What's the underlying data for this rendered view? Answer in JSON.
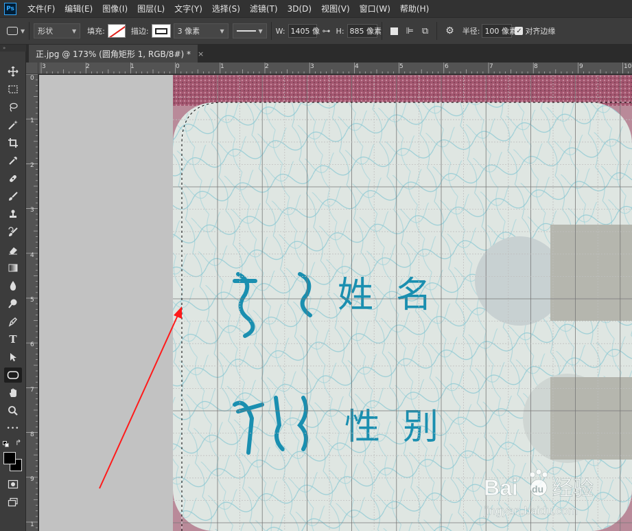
{
  "app": {
    "logo": "Ps"
  },
  "menu": [
    "文件(F)",
    "编辑(E)",
    "图像(I)",
    "图层(L)",
    "文字(Y)",
    "选择(S)",
    "滤镜(T)",
    "3D(D)",
    "视图(V)",
    "窗口(W)",
    "帮助(H)"
  ],
  "options": {
    "mode": "形状",
    "fill_label": "填充:",
    "stroke_label": "描边:",
    "stroke_width": "3 像素",
    "width_label": "W:",
    "width_value": "1405 像",
    "height_label": "H:",
    "height_value": "885 像素",
    "radius_label": "半径:",
    "radius_value": "100 像素",
    "align_edges_label": "对齐边缘",
    "align_edges_checked": true,
    "stroke_color": "#e0201a"
  },
  "document_tab": {
    "title": "正.jpg @ 173% (圆角矩形 1, RGB/8#) *",
    "close": "×"
  },
  "ruler": {
    "horizontal_labels": [
      "3",
      "2",
      "1",
      "0",
      "1",
      "2",
      "3",
      "4",
      "5",
      "6",
      "7",
      "8",
      "9",
      "10"
    ],
    "vertical_labels": [
      "0",
      "1",
      "2",
      "3",
      "4",
      "5",
      "6",
      "7",
      "8",
      "9",
      "1"
    ]
  },
  "toolbar": {
    "tools": [
      "move-tool-icon",
      "marquee-tool-icon",
      "lasso-tool-icon",
      "magic-wand-tool-icon",
      "crop-tool-icon",
      "eyedropper-tool-icon",
      "healing-brush-tool-icon",
      "brush-tool-icon",
      "clone-stamp-tool-icon",
      "history-brush-tool-icon",
      "eraser-tool-icon",
      "gradient-tool-icon",
      "blur-tool-icon",
      "dodge-tool-icon",
      "pen-tool-icon",
      "type-tool-icon",
      "path-selection-tool-icon",
      "rounded-rectangle-tool-icon",
      "hand-tool-icon",
      "zoom-tool-icon",
      "more-tools-icon"
    ],
    "active_tool": "rounded-rectangle-tool-icon",
    "type_tool_glyph": "T",
    "more_tools_glyph": "•••"
  },
  "document_content": {
    "field_name_label": "姓  名",
    "field_gender_label": "性  别",
    "watermark_brand": "Bai",
    "watermark_paw": "du",
    "watermark_site": "经验",
    "watermark_url": "jingyan.baidu.com"
  },
  "colors": {
    "accent_ps": "#31a8ff",
    "annotation_arrow": "#ff1a1a",
    "id_text": "#1a8fb0",
    "card_background": "#dfe6e2"
  }
}
